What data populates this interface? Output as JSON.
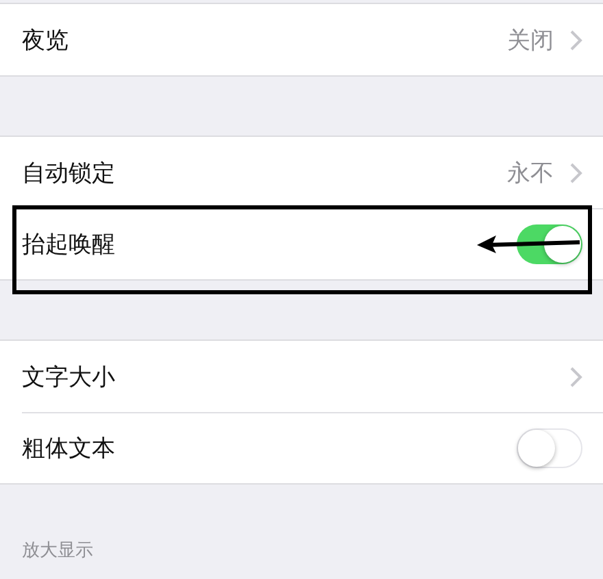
{
  "groups": [
    {
      "rows": [
        {
          "kind": "value",
          "label": "夜览",
          "value": "关闭",
          "highlighted": false
        }
      ]
    },
    {
      "rows": [
        {
          "kind": "value",
          "label": "自动锁定",
          "value": "永不",
          "highlighted": false
        },
        {
          "kind": "toggle",
          "label": "抬起唤醒",
          "on": true,
          "highlighted": true
        }
      ]
    },
    {
      "rows": [
        {
          "kind": "link",
          "label": "文字大小",
          "highlighted": false
        },
        {
          "kind": "toggle",
          "label": "粗体文本",
          "on": false,
          "highlighted": false
        }
      ]
    },
    {
      "header": "放大显示"
    }
  ]
}
